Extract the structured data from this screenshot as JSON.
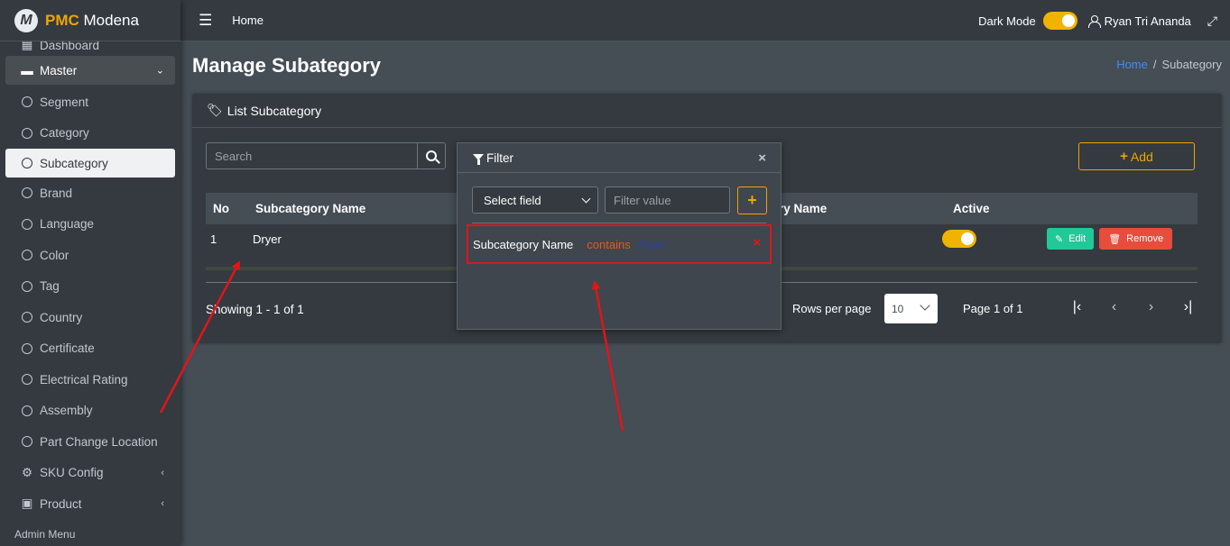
{
  "brand": {
    "logo_letter": "M",
    "name_bold": "PMC",
    "name_rest": "Modena"
  },
  "topbar": {
    "home": "Home",
    "dark_mode_label": "Dark Mode",
    "user_name": "Ryan Tri Ananda"
  },
  "sidebar": {
    "dashboard": "Dashboard",
    "master": "Master",
    "items": [
      "Segment",
      "Category",
      "Subcategory",
      "Brand",
      "Language",
      "Color",
      "Tag",
      "Country",
      "Certificate",
      "Electrical Rating",
      "Assembly",
      "Part Change Location"
    ],
    "active_item": "Subcategory",
    "sku_config": "SKU Config",
    "product": "Product",
    "admin_menu": "Admin Menu"
  },
  "page": {
    "title": "Manage Subategory"
  },
  "breadcrumb": {
    "home": "Home",
    "sep": "/",
    "current": "Subategory"
  },
  "card": {
    "title": "List Subcategory"
  },
  "search": {
    "placeholder": "Search",
    "value": ""
  },
  "add_button": {
    "label": "Add"
  },
  "table": {
    "headers": {
      "no": "No",
      "name": "Subcategory Name",
      "category_partial": "ry Name",
      "active": "Active"
    },
    "rows": [
      {
        "no": "1",
        "name": "Dryer",
        "active": true
      }
    ],
    "edit_label": "Edit",
    "remove_label": "Remove"
  },
  "footer": {
    "showing": "Showing 1 - 1 of 1",
    "rows_per_page_label": "Rows per page",
    "rows_per_page_value": "10",
    "page_info": "Page 1 of 1"
  },
  "filter": {
    "title": "Filter",
    "select_field_label": "Select field",
    "value_placeholder": "Filter value",
    "applied": {
      "field": "Subcategory Name",
      "operator": "contains",
      "value": "Dryer"
    }
  },
  "colors": {
    "accent": "#f0a500",
    "edit": "#20c997",
    "remove": "#e74c3c",
    "annotation": "#e0151b"
  }
}
